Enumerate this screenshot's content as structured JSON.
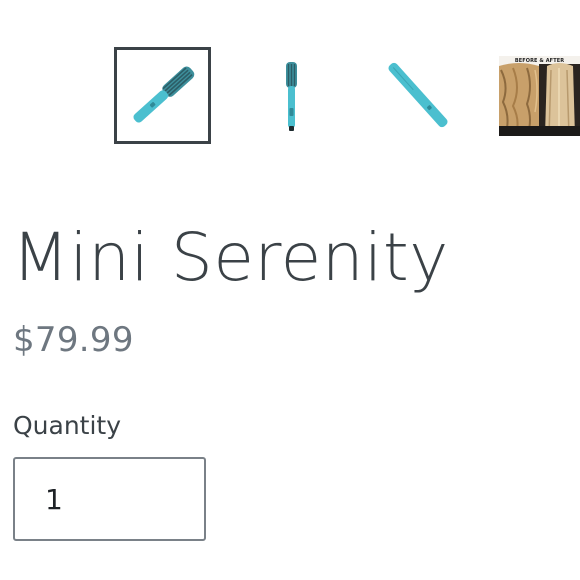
{
  "gallery": {
    "thumbnails": [
      {
        "name": "brush-side-view",
        "active": true
      },
      {
        "name": "brush-front-view",
        "active": false
      },
      {
        "name": "brush-back-view",
        "active": false
      },
      {
        "name": "before-after-photo",
        "active": false,
        "caption": "BEFORE & AFTER"
      }
    ]
  },
  "product": {
    "title": "Mini Serenity",
    "price": "$79.99"
  },
  "quantity": {
    "label": "Quantity",
    "value": "1"
  },
  "colors": {
    "brush": "#4bbfcf",
    "text_dark": "#3b4247",
    "price": "#6e7780"
  }
}
